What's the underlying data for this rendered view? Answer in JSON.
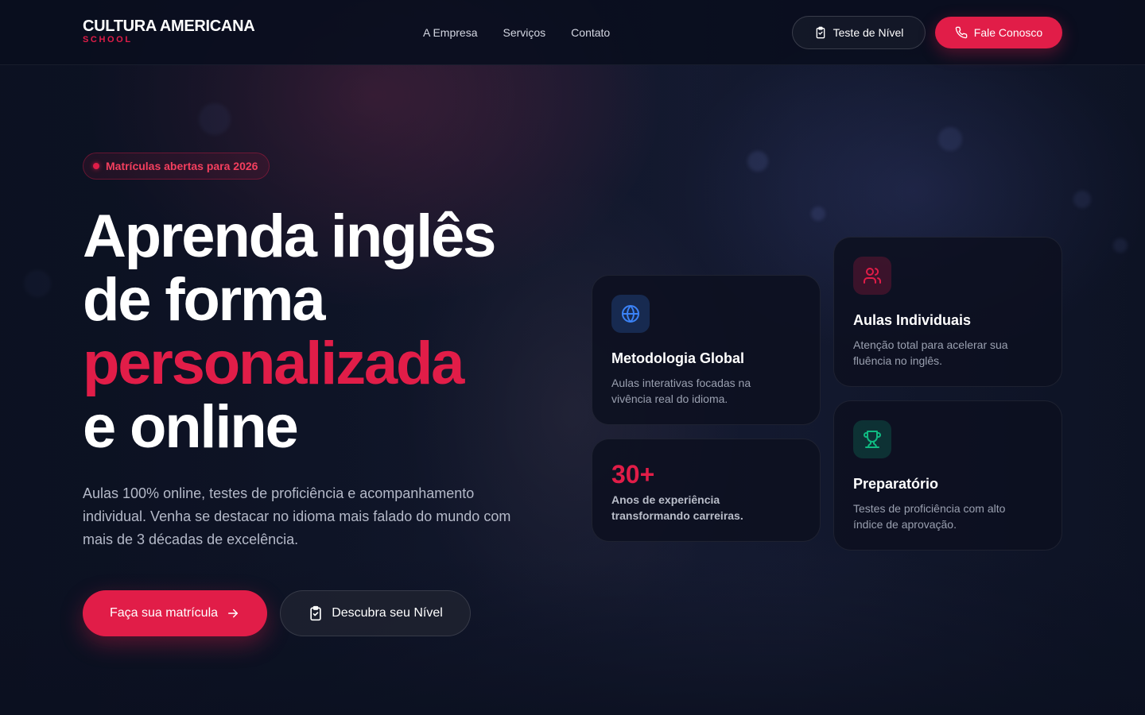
{
  "brand": {
    "name": "CULTURA AMERICANA",
    "tagline": "SCHOOL"
  },
  "nav": {
    "items": [
      "A Empresa",
      "Serviços",
      "Contato"
    ]
  },
  "header": {
    "level_test_label": "Teste de Nível",
    "contact_label": "Fale Conosco"
  },
  "hero": {
    "badge": "Matrículas abertas para 2026",
    "headline": {
      "line1": "Aprenda inglês",
      "line2": "de forma",
      "line3": "personalizada",
      "line4": "e online"
    },
    "lead": "Aulas 100% online, testes de proficiência e acompanhamento individual. Venha se destacar no idioma mais falado do mundo com mais de 3 décadas de excelência.",
    "cta_primary": "Faça sua matrícula",
    "cta_secondary": "Descubra seu Nível"
  },
  "cards": {
    "methodology": {
      "title": "Metodologia Global",
      "text": "Aulas interativas focadas na vivência real do idioma.",
      "icon": "globe-icon"
    },
    "experience": {
      "value": "30+",
      "text": "Anos de experiência transformando carreiras."
    },
    "individual": {
      "title": "Aulas Individuais",
      "text": "Atenção total para acelerar sua fluência no inglês.",
      "icon": "users-icon"
    },
    "prep": {
      "title": "Preparatório",
      "text": "Testes de proficiência com alto índice de aprovação.",
      "icon": "trophy-icon"
    }
  },
  "colors": {
    "accent": "#e11d48",
    "background": "#0b1020",
    "globe": "#3b82f6",
    "trophy": "#10b981"
  }
}
